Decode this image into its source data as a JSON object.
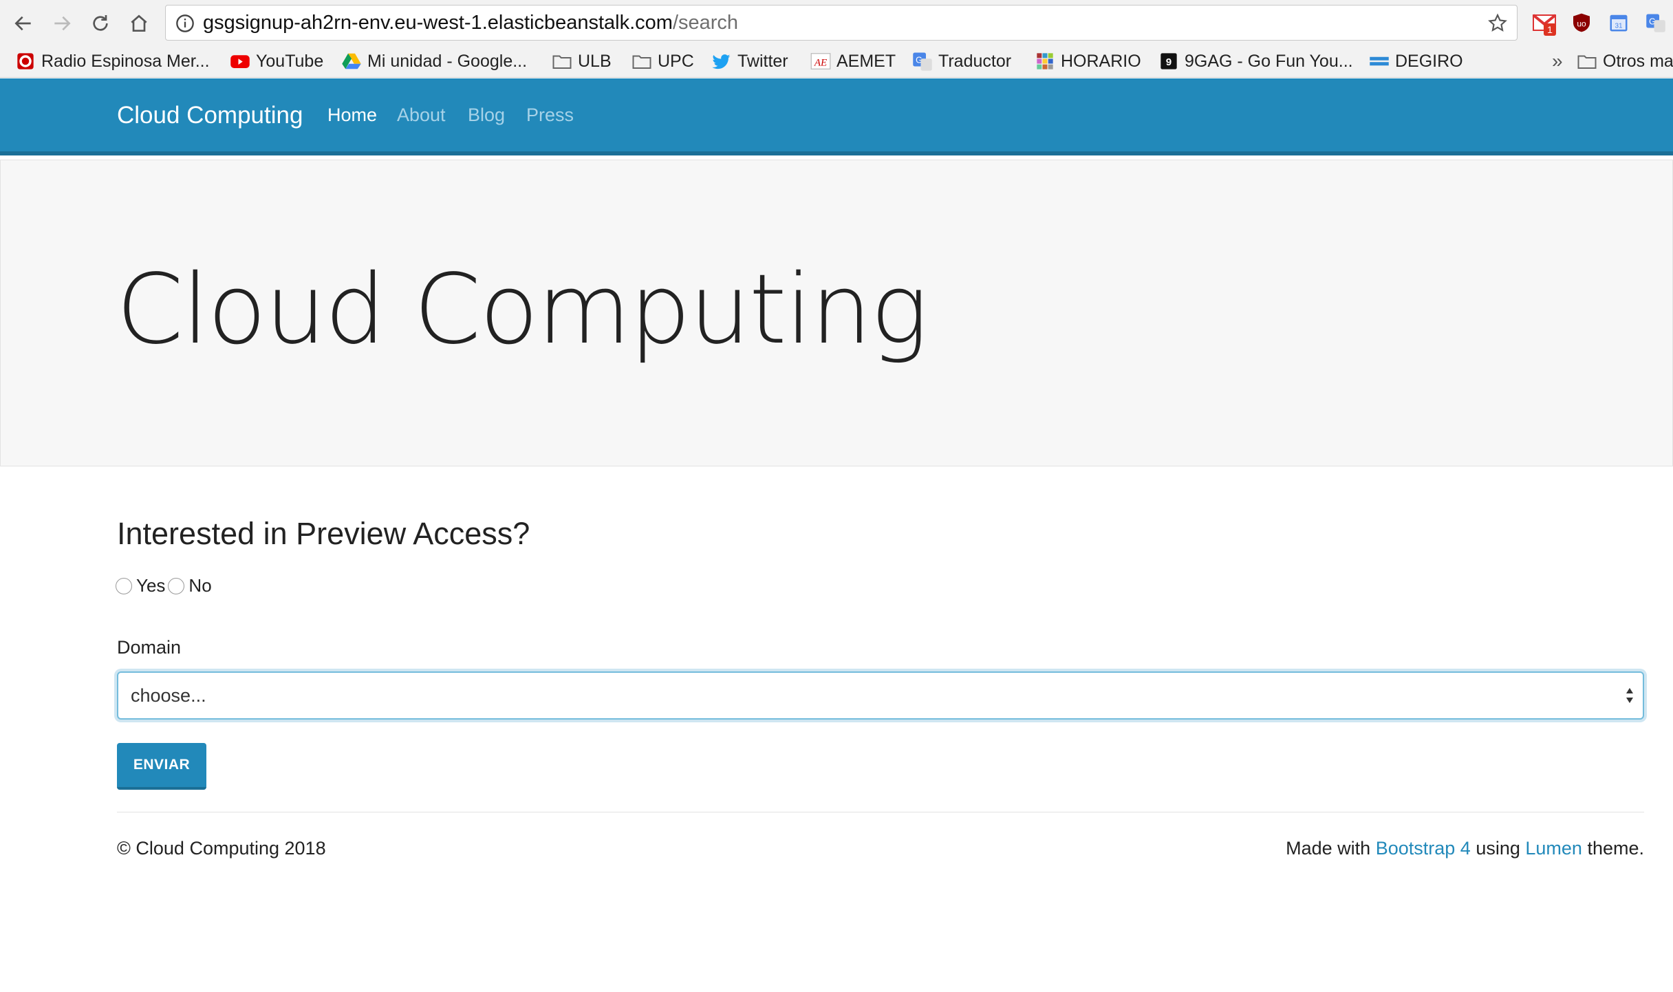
{
  "browser": {
    "url_host": "gsgsignup-ah2rn-env.eu-west-1.elasticbeanstalk.com",
    "url_path": "/search",
    "bookmarks": [
      "Radio Espinosa Mer...",
      "YouTube",
      "Mi unidad - Google...",
      "ULB",
      "UPC",
      "Twitter",
      "AEMET",
      "Traductor",
      "HORARIO",
      "9GAG - Go Fun You...",
      "DEGIRO"
    ],
    "bookmarks_overflow": "»",
    "other_bookmarks": "Otros ma",
    "gmail_badge": "1",
    "calendar_day": "31"
  },
  "navbar": {
    "brand": "Cloud Computing",
    "links": [
      "Home",
      "About",
      "Blog",
      "Press"
    ]
  },
  "jumbotron": {
    "title": "Cloud Computing"
  },
  "form": {
    "question": "Interested in Preview Access?",
    "options": [
      "Yes",
      "No"
    ],
    "domain_label": "Domain",
    "domain_value": "choose...",
    "submit_label": "ENVIAR"
  },
  "footer": {
    "copyright": "© Cloud Computing 2018",
    "made_with": "Made with",
    "bootstrap_link": "Bootstrap 4",
    "using": "using",
    "lumen_link": "Lumen",
    "theme": "theme."
  }
}
